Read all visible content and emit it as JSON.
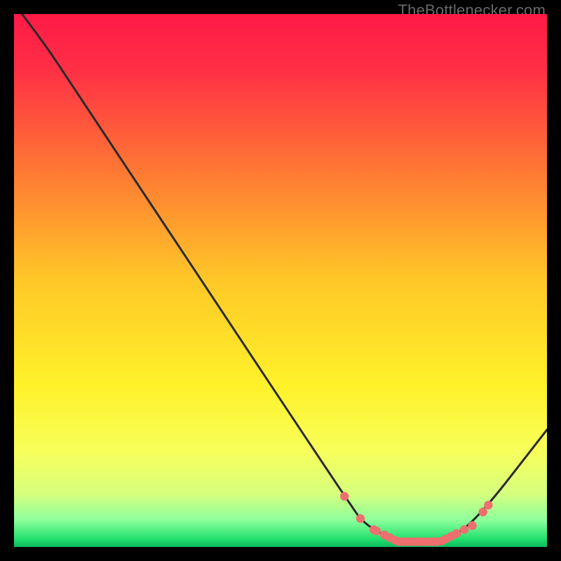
{
  "attribution": "TheBottlenecker.com",
  "chart_data": {
    "type": "line",
    "title": "",
    "xlabel": "",
    "ylabel": "",
    "xlim": [
      0,
      100
    ],
    "ylim": [
      0,
      100
    ],
    "grid": false,
    "curve": [
      {
        "x": 0,
        "y": 102
      },
      {
        "x": 6,
        "y": 94
      },
      {
        "x": 10,
        "y": 88
      },
      {
        "x": 63,
        "y": 8
      },
      {
        "x": 66,
        "y": 4
      },
      {
        "x": 72,
        "y": 1
      },
      {
        "x": 80,
        "y": 1
      },
      {
        "x": 86,
        "y": 4
      },
      {
        "x": 100,
        "y": 22
      }
    ],
    "markers_x": [
      62,
      65,
      67.5,
      68,
      69.5,
      70.5,
      71.5,
      72.2,
      73,
      73.8,
      74.6,
      75.4,
      76.2,
      77,
      77.8,
      78.6,
      79.4,
      80.2,
      81,
      82,
      83,
      84.5,
      86,
      88,
      89
    ],
    "gradient_stops": [
      {
        "offset": 0.0,
        "color": "#ff1a46"
      },
      {
        "offset": 0.1,
        "color": "#ff2e46"
      },
      {
        "offset": 0.3,
        "color": "#ff7a33"
      },
      {
        "offset": 0.5,
        "color": "#ffc827"
      },
      {
        "offset": 0.7,
        "color": "#fff22a"
      },
      {
        "offset": 0.82,
        "color": "#f7ff5a"
      },
      {
        "offset": 0.9,
        "color": "#d6ff7e"
      },
      {
        "offset": 0.95,
        "color": "#8cff9c"
      },
      {
        "offset": 0.985,
        "color": "#22e06e"
      },
      {
        "offset": 1.0,
        "color": "#0db85c"
      }
    ],
    "marker_color": "#ef6e6e",
    "curve_stroke": "#2a2a2a"
  }
}
